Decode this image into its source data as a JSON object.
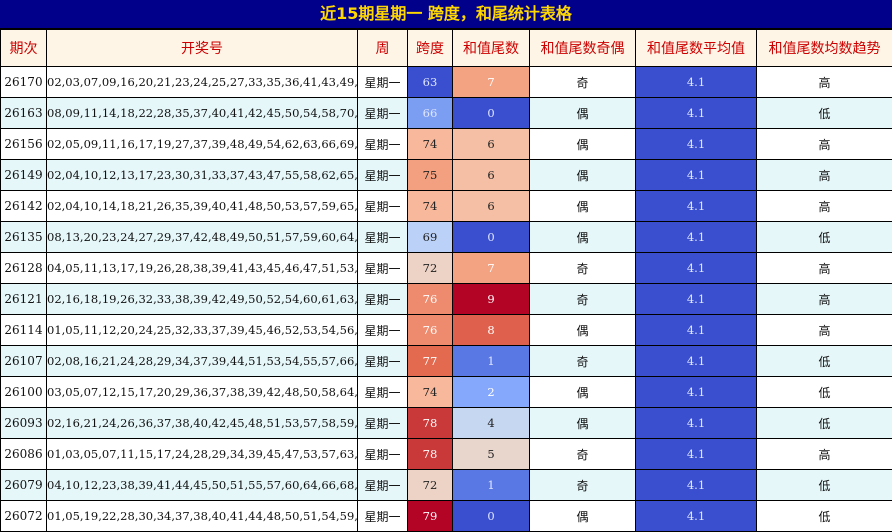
{
  "title": "近15期星期一 跨度，和尾统计表格",
  "headers": [
    "期次",
    "开奖号",
    "周",
    "跨度",
    "和值尾数",
    "和值尾数奇偶",
    "和值尾数平均值",
    "和值尾数均数趋势"
  ],
  "rows": [
    {
      "period": "26170",
      "numbers": "02,03,07,09,16,20,21,23,24,25,27,33,35,36,41,43,49,51,57,65",
      "week": "星期一",
      "span": "63",
      "tail": "7",
      "parity": "奇",
      "avg": "4.1",
      "trend": "高",
      "span_color": "#3a4fcf",
      "span_text": "#dfe6ff",
      "tail_color": "#f4a382",
      "tail_text": "#ffffff"
    },
    {
      "period": "26163",
      "numbers": "08,09,11,14,18,22,28,35,37,40,41,42,45,50,54,58,70,71,73,74",
      "week": "星期一",
      "span": "66",
      "tail": "0",
      "parity": "偶",
      "avg": "4.1",
      "trend": "低",
      "span_color": "#7b9df2",
      "span_text": "#dfe6ff",
      "tail_color": "#3a4fcf",
      "tail_text": "#dfe6ff"
    },
    {
      "period": "26156",
      "numbers": "02,05,09,11,16,17,19,27,37,39,48,49,54,62,63,66,69,70,71,73,76",
      "week": "星期一",
      "span": "74",
      "tail": "6",
      "parity": "偶",
      "avg": "4.1",
      "trend": "高",
      "span_color": "#f7b89c",
      "span_text": "#222222",
      "tail_color": "#f4bfa5",
      "tail_text": "#222222"
    },
    {
      "period": "26149",
      "numbers": "02,04,10,12,13,17,23,30,31,33,37,43,47,55,58,62,65,72,75,77",
      "week": "星期一",
      "span": "75",
      "tail": "6",
      "parity": "偶",
      "avg": "4.1",
      "trend": "高",
      "span_color": "#f2a080",
      "span_text": "#222222",
      "tail_color": "#f4bfa5",
      "tail_text": "#222222"
    },
    {
      "period": "26142",
      "numbers": "02,04,10,14,18,21,26,35,39,40,41,48,50,53,57,59,65,73,75,76",
      "week": "星期一",
      "span": "74",
      "tail": "6",
      "parity": "偶",
      "avg": "4.1",
      "trend": "高",
      "span_color": "#f7b89c",
      "span_text": "#222222",
      "tail_color": "#f4bfa5",
      "tail_text": "#222222"
    },
    {
      "period": "26135",
      "numbers": "08,13,20,23,24,27,29,37,42,48,49,50,51,57,59,60,64,65,67,77",
      "week": "星期一",
      "span": "69",
      "tail": "0",
      "parity": "偶",
      "avg": "4.1",
      "trend": "低",
      "span_color": "#bcd1f8",
      "span_text": "#222222",
      "tail_color": "#3a4fcf",
      "tail_text": "#dfe6ff"
    },
    {
      "period": "26128",
      "numbers": "04,05,11,13,17,19,26,28,38,39,41,43,45,46,47,51,53,60,75,76",
      "week": "星期一",
      "span": "72",
      "tail": "7",
      "parity": "奇",
      "avg": "4.1",
      "trend": "高",
      "span_color": "#ecd3c6",
      "span_text": "#222222",
      "tail_color": "#f4a382",
      "tail_text": "#ffffff"
    },
    {
      "period": "26121",
      "numbers": "02,16,18,19,26,32,33,38,39,42,49,50,52,54,60,61,63,65,72,78",
      "week": "星期一",
      "span": "76",
      "tail": "9",
      "parity": "奇",
      "avg": "4.1",
      "trend": "高",
      "span_color": "#ee8a6e",
      "span_text": "#ffffff",
      "tail_color": "#b40426",
      "tail_text": "#ffffff"
    },
    {
      "period": "26114",
      "numbers": "01,05,11,12,20,24,25,32,33,37,39,45,46,52,53,54,56,57,69,77",
      "week": "星期一",
      "span": "76",
      "tail": "8",
      "parity": "偶",
      "avg": "4.1",
      "trend": "高",
      "span_color": "#ee8a6e",
      "span_text": "#ffffff",
      "tail_color": "#de604d",
      "tail_text": "#ffffff"
    },
    {
      "period": "26107",
      "numbers": "02,08,16,21,24,28,29,34,37,39,44,51,53,54,55,57,66,69,75,79",
      "week": "星期一",
      "span": "77",
      "tail": "1",
      "parity": "奇",
      "avg": "4.1",
      "trend": "低",
      "span_color": "#e3694f",
      "span_text": "#ffffff",
      "tail_color": "#5a78e4",
      "tail_text": "#dfe6ff"
    },
    {
      "period": "26100",
      "numbers": "03,05,07,12,15,17,20,29,36,37,38,39,42,48,50,58,64,67,68,77",
      "week": "星期一",
      "span": "74",
      "tail": "2",
      "parity": "偶",
      "avg": "4.1",
      "trend": "低",
      "span_color": "#f7b89c",
      "span_text": "#222222",
      "tail_color": "#85a8fc",
      "tail_text": "#ffffff"
    },
    {
      "period": "26093",
      "numbers": "02,16,21,24,26,36,37,38,40,42,45,48,51,53,57,58,59,62,69,80",
      "week": "星期一",
      "span": "78",
      "tail": "4",
      "parity": "偶",
      "avg": "4.1",
      "trend": "低",
      "span_color": "#c9393a",
      "span_text": "#ffffff",
      "tail_color": "#c6d7f2",
      "tail_text": "#222222"
    },
    {
      "period": "26086",
      "numbers": "01,03,05,07,11,15,17,24,28,29,34,39,45,47,53,57,63,66,72,79",
      "week": "星期一",
      "span": "78",
      "tail": "5",
      "parity": "奇",
      "avg": "4.1",
      "trend": "高",
      "span_color": "#c9393a",
      "span_text": "#ffffff",
      "tail_color": "#e8d5cb",
      "tail_text": "#222222"
    },
    {
      "period": "26079",
      "numbers": "04,10,12,23,38,39,41,44,45,50,51,55,57,60,64,66,68,73,75,76",
      "week": "星期一",
      "span": "72",
      "tail": "1",
      "parity": "奇",
      "avg": "4.1",
      "trend": "低",
      "span_color": "#ecd3c6",
      "span_text": "#222222",
      "tail_color": "#5a78e4",
      "tail_text": "#dfe6ff"
    },
    {
      "period": "26072",
      "numbers": "01,05,19,22,28,30,34,37,38,40,41,44,48,50,51,54,59,74,75,80",
      "week": "星期一",
      "span": "79",
      "tail": "0",
      "parity": "偶",
      "avg": "4.1",
      "trend": "低",
      "span_color": "#b40426",
      "span_text": "#ffffff",
      "tail_color": "#3a4fcf",
      "tail_text": "#dfe6ff"
    }
  ]
}
